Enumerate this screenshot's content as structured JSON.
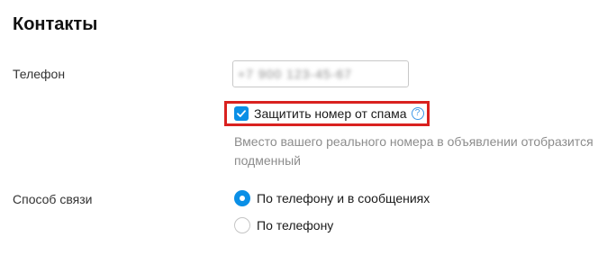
{
  "section": {
    "title": "Контакты"
  },
  "phone": {
    "label": "Телефон",
    "value": "+7 900 123-45-67"
  },
  "spam_protection": {
    "label": "Защитить номер от спама",
    "checked": true,
    "help_icon": "question-circle-icon",
    "hint": "Вместо вашего реального номера в объявлении отобразится подменный"
  },
  "contact_method": {
    "label": "Способ связи",
    "options": [
      {
        "label": "По телефону и в сообщениях",
        "selected": true
      },
      {
        "label": "По телефону",
        "selected": false
      }
    ]
  },
  "colors": {
    "accent": "#0a8fe6",
    "highlight_border": "#d9211f",
    "hint_text": "#8c8c8c"
  }
}
